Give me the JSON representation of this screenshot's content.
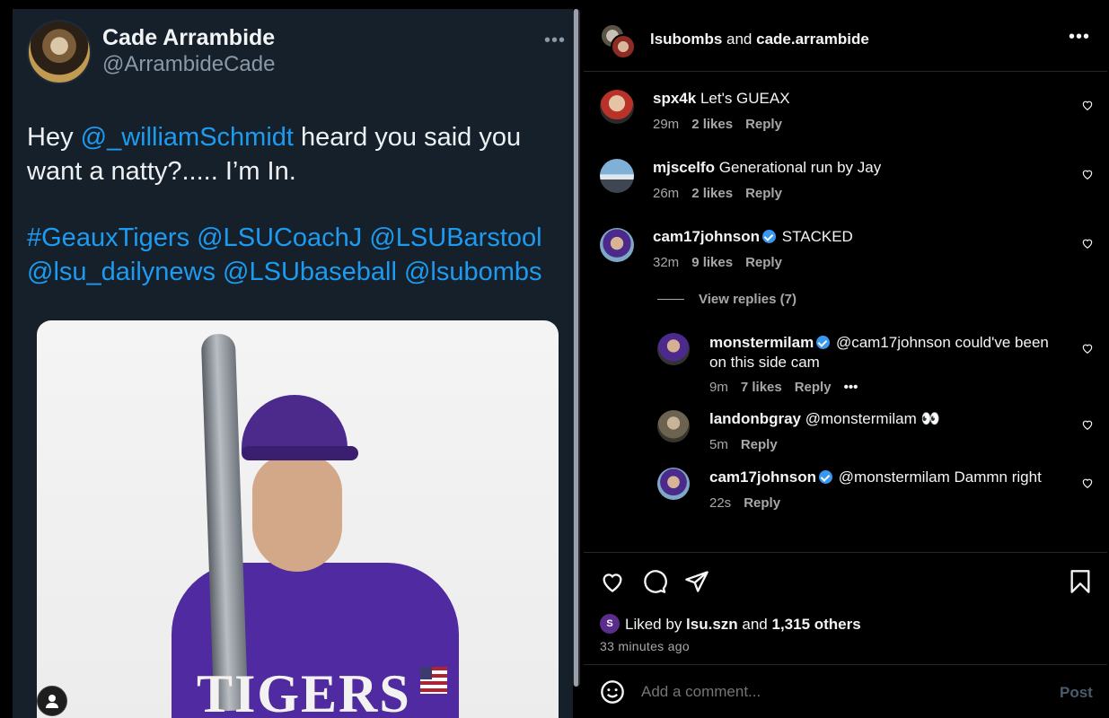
{
  "tweet": {
    "author_name": "Cade Arrambide",
    "author_handle": "@ArrambideCade",
    "more": "•••",
    "text_prefix": "Hey ",
    "text_mention": "@_williamSchmidt",
    "text_suffix": " heard you said you want a natty?..... I’m In.",
    "hashtags_line1": "#GeauxTigers @LSUCoachJ @LSUBarstool",
    "hashtags_line2": "@lsu_dailynews @LSUbaseball @lsubombs",
    "photo_text": "TIGERS"
  },
  "instagram": {
    "header": {
      "user1": "lsubombs",
      "and": " and ",
      "user2": "cade.arrambide",
      "more": "•••"
    },
    "comments": [
      {
        "user": "spx4k",
        "text": "Let's GUEAX",
        "time": "29m",
        "likes": "2 likes",
        "reply": "Reply",
        "verified": false
      },
      {
        "user": "mjscelfo",
        "text": "Generational run by Jay",
        "time": "26m",
        "likes": "2 likes",
        "reply": "Reply",
        "verified": false
      },
      {
        "user": "cam17johnson",
        "text": "STACKED",
        "time": "32m",
        "likes": "9 likes",
        "reply": "Reply",
        "verified": true
      }
    ],
    "view_replies": "View replies (7)",
    "replies": [
      {
        "user": "monstermilam",
        "text": "@cam17johnson could've been on this side cam",
        "time": "9m",
        "likes": "7 likes",
        "reply": "Reply",
        "more": "•••",
        "verified": true
      },
      {
        "user": "landonbgray",
        "text": "@monstermilam 👀",
        "time": "5m",
        "reply": "Reply",
        "verified": false
      },
      {
        "user": "cam17johnson",
        "text": "@monstermilam Dammn right",
        "time": "22s",
        "reply": "Reply",
        "verified": true
      }
    ],
    "liked_by_prefix": "Liked by ",
    "liked_by_user": "lsu.szn",
    "liked_by_and": " and ",
    "liked_by_others": "1,315 others",
    "liked_avatar_letter": "S",
    "time_ago": "33 minutes ago",
    "add_comment_placeholder": "Add a comment...",
    "post_label": "Post"
  }
}
